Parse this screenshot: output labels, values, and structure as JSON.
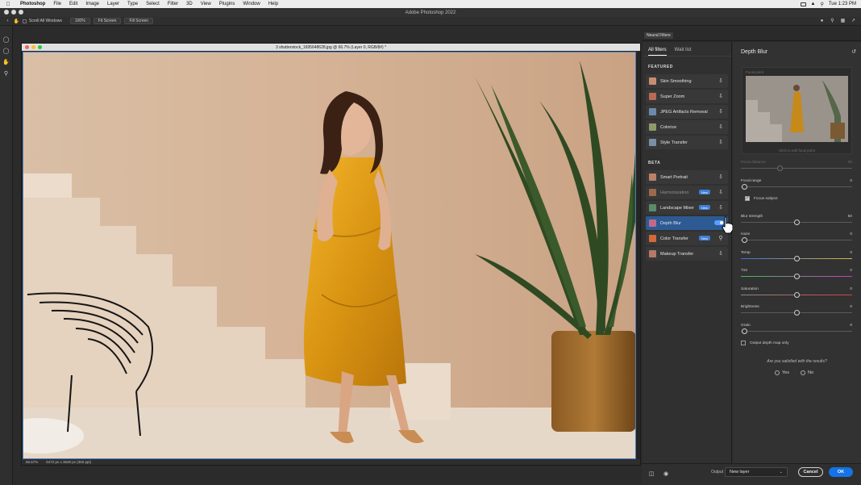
{
  "menubar": {
    "items": [
      "Photoshop",
      "File",
      "Edit",
      "Image",
      "Layer",
      "Type",
      "Select",
      "Filter",
      "3D",
      "View",
      "Plugins",
      "Window",
      "Help"
    ],
    "clock": "Tue 1:23 PM"
  },
  "app": {
    "title": "Adobe Photoshop 2022"
  },
  "options": {
    "scroll_all_label": "Scroll All Windows",
    "zoom_100": "100%",
    "fit_screen": "Fit Screen",
    "fill_screen": "Fill Screen"
  },
  "document": {
    "title": "3 shutterstock_1695648628.jpg @ 66.7% (Layer 0, RGB/8#) *",
    "zoom": "66.67%",
    "dimensions": "5472 px x 3648 px (350 ppi)"
  },
  "neural_filters": {
    "panel_title": "Neural Filters",
    "tabs": {
      "all": "All filters",
      "wait": "Wait list"
    },
    "featured_heading": "FEATURED",
    "beta_heading": "BETA",
    "featured": [
      {
        "label": "Skin Smoothing",
        "icon": "cloud-download-icon"
      },
      {
        "label": "Super Zoom",
        "icon": "cloud-download-icon"
      },
      {
        "label": "JPEG Artifacts Removal",
        "icon": "cloud-download-icon"
      },
      {
        "label": "Colorize",
        "icon": "cloud-download-icon"
      },
      {
        "label": "Style Transfer",
        "icon": "cloud-download-icon"
      }
    ],
    "beta": [
      {
        "label": "Smart Portrait",
        "icon": "cloud-download-icon"
      },
      {
        "label": "Harmonization",
        "badge": "New",
        "icon": "cloud-download-icon"
      },
      {
        "label": "Landscape Mixer",
        "badge": "New",
        "icon": "cloud-download-icon"
      },
      {
        "label": "Depth Blur",
        "toggle": true
      },
      {
        "label": "Color Transfer",
        "badge": "New",
        "icon": "search-icon"
      },
      {
        "label": "Makeup Transfer",
        "icon": "cloud-download-icon"
      }
    ]
  },
  "depth_blur": {
    "title": "Depth Blur",
    "focal_point_label": "Focal point",
    "focal_hint": "Click to edit focal point",
    "focal_distance": {
      "label": "Focal distance",
      "value": "25"
    },
    "focal_range": {
      "label": "Focal range",
      "value": "0"
    },
    "focus_subject": "Focus subject",
    "blur_strength": {
      "label": "Blur strength",
      "value": "50"
    },
    "haze": {
      "label": "Haze",
      "value": "0"
    },
    "temp": {
      "label": "Temp",
      "value": "0"
    },
    "tint": {
      "label": "Tint",
      "value": "0"
    },
    "saturation": {
      "label": "Saturation",
      "value": "0"
    },
    "brightness": {
      "label": "Brightness",
      "value": "0"
    },
    "grain": {
      "label": "Grain",
      "value": "0"
    },
    "output_depth_map": "Output depth map only",
    "satisfied": "Are you satisfied with the results?",
    "yes": "Yes",
    "no": "No"
  },
  "footer": {
    "output_label": "Output",
    "output_value": "New layer",
    "cancel": "Cancel",
    "ok": "OK"
  }
}
